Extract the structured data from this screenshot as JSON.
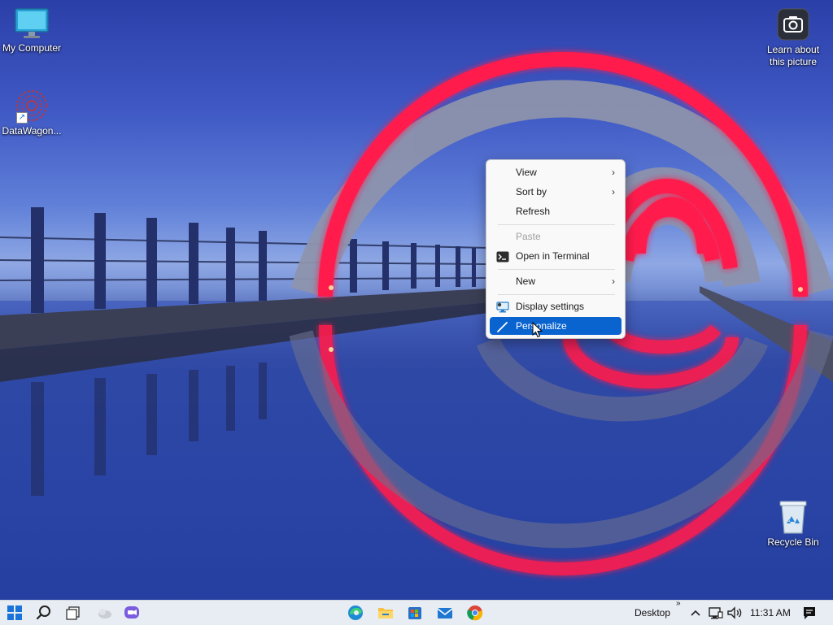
{
  "desktop": {
    "icons": [
      {
        "label": "My Computer"
      },
      {
        "label": "DataWagon..."
      },
      {
        "label": "Learn about this picture"
      },
      {
        "label": "Recycle Bin"
      }
    ]
  },
  "context_menu": {
    "items": [
      {
        "label": "View",
        "submenu": true
      },
      {
        "label": "Sort by",
        "submenu": true
      },
      {
        "label": "Refresh"
      },
      {
        "label": "Paste",
        "disabled": true
      },
      {
        "label": "Open in Terminal",
        "icon": "terminal-icon"
      },
      {
        "label": "New",
        "submenu": true
      },
      {
        "label": "Display settings",
        "icon": "display-settings-icon"
      },
      {
        "label": "Personalize",
        "icon": "brush-icon",
        "highlighted": true
      }
    ]
  },
  "taskbar": {
    "toolbar_label": "Desktop",
    "toolbar_overflow": "»",
    "clock": "11:31 AM",
    "pinned": [
      "start-icon",
      "search-icon",
      "task-view-icon",
      "widgets-icon",
      "chat-icon",
      "edge-icon",
      "file-explorer-icon",
      "store-icon",
      "mail-icon",
      "chrome-icon"
    ],
    "tray": [
      "chevron-up-icon",
      "network-icon",
      "volume-icon",
      "notification-icon"
    ]
  },
  "colors": {
    "accent": "#0a64d0",
    "menu_bg": "#f9f9f9",
    "taskbar_bg": "#e8ecf3"
  }
}
